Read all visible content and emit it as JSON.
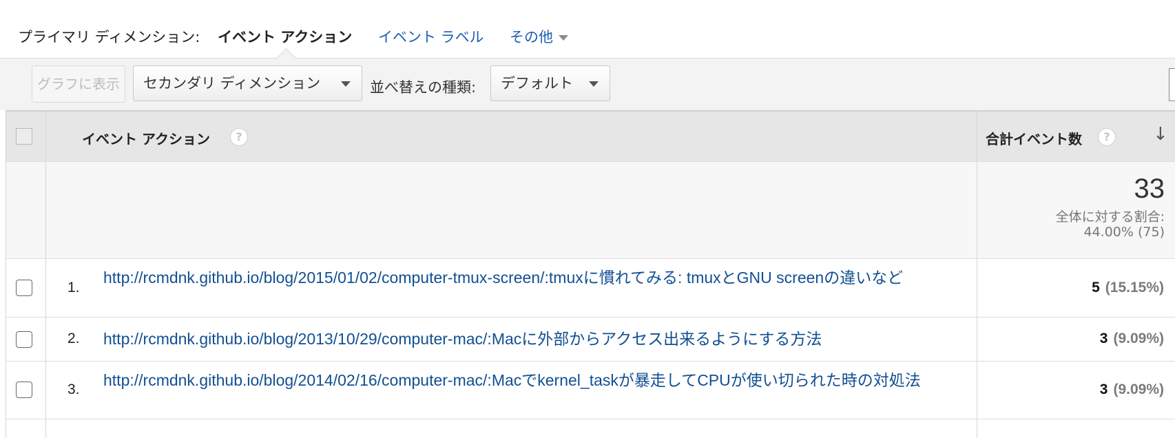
{
  "dimension_bar": {
    "label": "プライマリ ディメンション:",
    "current": "イベント アクション",
    "links": [
      "イベント ラベル",
      "その他"
    ]
  },
  "toolbar": {
    "graph_button": "グラフに表示",
    "secondary_dimension": "セカンダリ ディメンション",
    "sort_label": "並べ替えの種類:",
    "sort_value": "デフォルト"
  },
  "table": {
    "col_action": "イベント アクション",
    "col_total": "合計イベント数",
    "help_glyph": "?",
    "sort_glyph": "↓",
    "summary": {
      "total": "33",
      "ratio_label": "全体に対する割合:",
      "ratio_value": "44.00% (75)"
    },
    "rows": [
      {
        "index": "1.",
        "action": "http://rcmdnk.github.io/blog/2015/01/02/computer-tmux-screen/:tmuxに慣れてみる: tmuxとGNU screenの違いなど",
        "count": "5",
        "percent": "(15.15%)"
      },
      {
        "index": "2.",
        "action": "http://rcmdnk.github.io/blog/2013/10/29/computer-mac/:Macに外部からアクセス出来るようにする方法",
        "count": "3",
        "percent": "(9.09%)"
      },
      {
        "index": "3.",
        "action": "http://rcmdnk.github.io/blog/2014/02/16/computer-mac/:Macでkernel_taskが暴走してCPUが使い切られた時の対処法",
        "count": "3",
        "percent": "(9.09%)"
      }
    ]
  },
  "colors": {
    "link": "#124f92",
    "nav_link": "#1a5fb4",
    "header_bg": "#e6e6e6",
    "toolbar_bg": "#f3f3f3"
  }
}
